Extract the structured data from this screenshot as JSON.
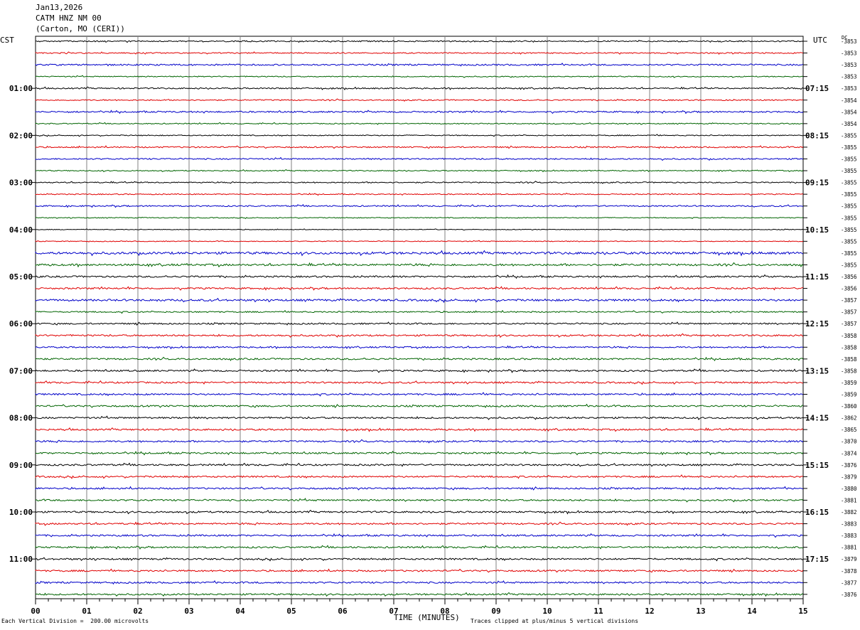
{
  "header": {
    "date": "Jan13,2026",
    "station": "CATM HNZ NM 00",
    "location": "(Carton, MO (CERI))"
  },
  "left_tz": "CST",
  "right_tz": "UTC",
  "dc_label": "DC",
  "footer": {
    "scale": "Each Vertical Division =  200.00 microvolts",
    "xlabel": "TIME (MINUTES)",
    "clip": "Traces clipped at plus/minus 5 vertical divisions"
  },
  "chart_data": {
    "type": "line",
    "title": "",
    "xlabel": "TIME (MINUTES)",
    "xlim": [
      0,
      15
    ],
    "x_ticks": [
      "00",
      "01",
      "02",
      "03",
      "04",
      "05",
      "06",
      "07",
      "08",
      "09",
      "10",
      "11",
      "12",
      "13",
      "14",
      "15"
    ],
    "grid": true,
    "trace_colors": [
      "#000000",
      "#e00000",
      "#0000c8",
      "#006400"
    ],
    "hour_labels": [
      {
        "row": 4,
        "cst": "01:00",
        "utc": "07:15"
      },
      {
        "row": 8,
        "cst": "02:00",
        "utc": "08:15"
      },
      {
        "row": 12,
        "cst": "03:00",
        "utc": "09:15"
      },
      {
        "row": 16,
        "cst": "04:00",
        "utc": "10:15"
      },
      {
        "row": 20,
        "cst": "05:00",
        "utc": "11:15"
      },
      {
        "row": 24,
        "cst": "06:00",
        "utc": "12:15"
      },
      {
        "row": 28,
        "cst": "07:00",
        "utc": "13:15"
      },
      {
        "row": 32,
        "cst": "08:00",
        "utc": "14:15"
      },
      {
        "row": 36,
        "cst": "09:00",
        "utc": "15:15"
      },
      {
        "row": 40,
        "cst": "10:00",
        "utc": "16:15"
      },
      {
        "row": 44,
        "cst": "11:00",
        "utc": "17:15"
      }
    ],
    "dc_offsets": [
      "-3853",
      "-3853",
      "-3853",
      "-3853",
      "-3853",
      "-3854",
      "-3854",
      "-3854",
      "-3855",
      "-3855",
      "-3855",
      "-3855",
      "-3855",
      "-3855",
      "-3855",
      "-3855",
      "-3855",
      "-3855",
      "-3855",
      "-3855",
      "-3856",
      "-3856",
      "-3857",
      "-3857",
      "-3857",
      "-3858",
      "-3858",
      "-3858",
      "-3858",
      "-3859",
      "-3859",
      "-3860",
      "-3862",
      "-3865",
      "-3870",
      "-3874",
      "-3876",
      "-3879",
      "-3880",
      "-3881",
      "-3882",
      "-3883",
      "-3883",
      "-3881",
      "-3879",
      "-3878",
      "-3877",
      "-3876"
    ],
    "trace_noise": [
      0.8,
      0.7,
      0.9,
      0.6,
      0.8,
      0.7,
      0.9,
      0.6,
      0.6,
      0.8,
      0.8,
      0.6,
      0.7,
      0.6,
      0.8,
      0.5,
      0.4,
      0.5,
      1.4,
      1.2,
      1.0,
      1.0,
      1.2,
      0.8,
      0.9,
      1.0,
      0.9,
      1.0,
      1.0,
      1.0,
      1.0,
      1.0,
      1.0,
      1.0,
      1.0,
      1.0,
      1.0,
      1.0,
      1.0,
      1.0,
      1.0,
      1.0,
      1.0,
      1.0,
      1.0,
      1.0,
      1.0,
      1.0
    ]
  }
}
